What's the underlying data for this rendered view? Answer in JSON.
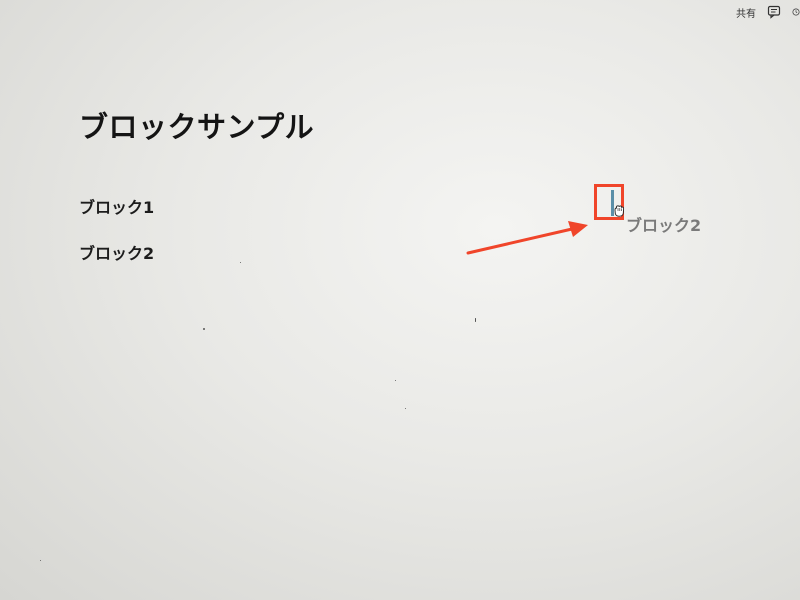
{
  "topbar": {
    "share_label": "共有",
    "comment_icon": "comment-icon",
    "more_icon": "clock-icon"
  },
  "page": {
    "title": "ブロックサンプル",
    "blocks": [
      {
        "label": "ブロック1"
      },
      {
        "label": "ブロック2"
      }
    ]
  },
  "drag": {
    "ghost_label": "ブロック2"
  },
  "colors": {
    "highlight": "#f0452a",
    "arrow": "#f0452a",
    "drop_indicator": "#5b8fa8"
  }
}
